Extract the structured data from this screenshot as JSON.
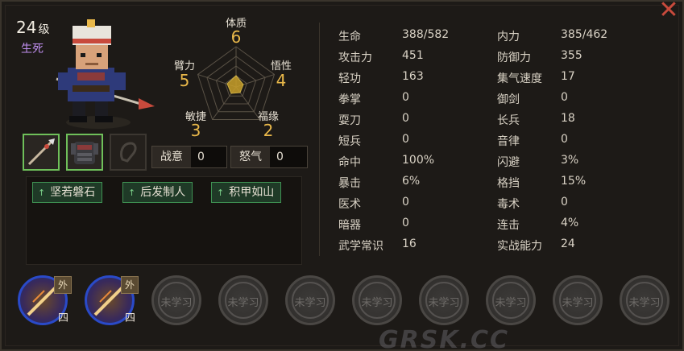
{
  "character": {
    "level": "24",
    "level_unit": "级",
    "state": "生死"
  },
  "radar": {
    "top": {
      "label": "体质",
      "value": "6"
    },
    "upper_left": {
      "label": "臂力",
      "value": "5"
    },
    "upper_right": {
      "label": "悟性",
      "value": "4"
    },
    "lower_left": {
      "label": "敏捷",
      "value": "3"
    },
    "lower_right": {
      "label": "福缘",
      "value": "2"
    }
  },
  "equipment": {
    "weapon_icon": "spear-icon",
    "armor_icon": "armor-icon",
    "accessory_icon": "accessory-empty-icon"
  },
  "stats_small": {
    "zhanyi_label": "战意",
    "zhanyi_value": "0",
    "nuqi_label": "怒气",
    "nuqi_value": "0"
  },
  "traits": [
    "坚若磐石",
    "后发制人",
    "积甲如山"
  ],
  "attributes_left": [
    {
      "label": "生命",
      "value": "388/582"
    },
    {
      "label": "攻击力",
      "value": "451"
    },
    {
      "label": "轻功",
      "value": "163"
    },
    {
      "label": "拳掌",
      "value": "0"
    },
    {
      "label": "耍刀",
      "value": "0"
    },
    {
      "label": "短兵",
      "value": "0"
    },
    {
      "label": "命中",
      "value": "100%"
    },
    {
      "label": "暴击",
      "value": "6%"
    },
    {
      "label": "医术",
      "value": "0"
    },
    {
      "label": "暗器",
      "value": "0"
    },
    {
      "label": "武学常识",
      "value": "16"
    }
  ],
  "attributes_right": [
    {
      "label": "内力",
      "value": "385/462"
    },
    {
      "label": "防御力",
      "value": "355"
    },
    {
      "label": "集气速度",
      "value": "17"
    },
    {
      "label": "御剑",
      "value": "0"
    },
    {
      "label": "长兵",
      "value": "18"
    },
    {
      "label": "音律",
      "value": "0"
    },
    {
      "label": "闪避",
      "value": "3%"
    },
    {
      "label": "格挡",
      "value": "15%"
    },
    {
      "label": "毒术",
      "value": "0"
    },
    {
      "label": "连击",
      "value": "4%"
    },
    {
      "label": "实战能力",
      "value": "24"
    }
  ],
  "skills": {
    "learned": [
      {
        "tag": "外",
        "rank": "四",
        "icon": "spear-thrust-icon"
      },
      {
        "tag": "外",
        "rank": "四",
        "icon": "spear-burst-icon"
      }
    ],
    "empty_label": "未学习",
    "empty_count": 8
  },
  "watermark": "GRSK.CC",
  "colors": {
    "accent_value": "#e9b84a",
    "state_purple": "#c290f2",
    "trait_green": "#1f3a27",
    "equip_border": "#6fc05a",
    "close_red": "#c84a3c"
  }
}
